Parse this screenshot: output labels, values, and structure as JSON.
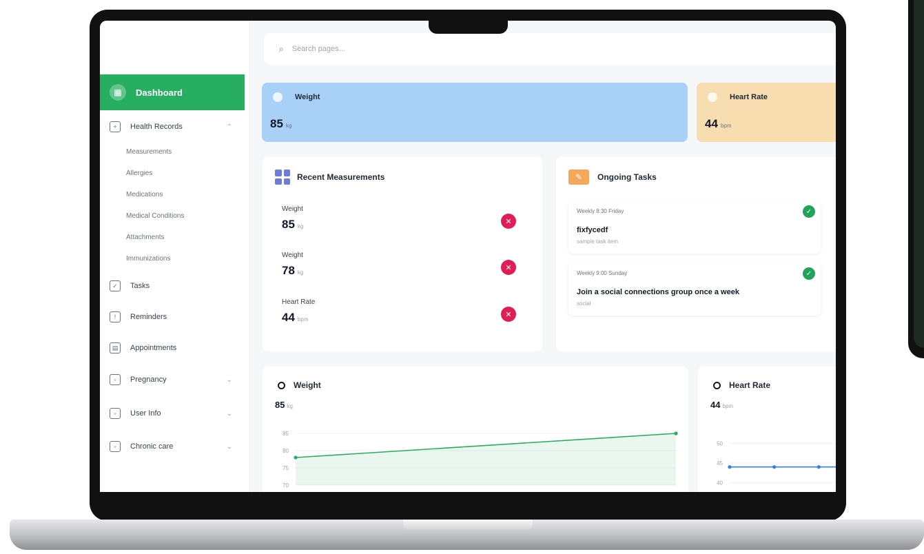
{
  "search": {
    "placeholder": "Search pages..."
  },
  "sidebar": {
    "active": "Dashboard",
    "health_records": "Health Records",
    "sub_items": [
      "Measurements",
      "Allergies",
      "Medications",
      "Medical Conditions",
      "Attachments",
      "Immunizations"
    ],
    "items": [
      "Tasks",
      "Reminders",
      "Appointments",
      "Pregnancy",
      "User Info",
      "Chronic care"
    ]
  },
  "stats": [
    {
      "label": "Weight",
      "value": "85",
      "unit": "kg",
      "color": "#a9d0f7"
    },
    {
      "label": "Heart Rate",
      "value": "44",
      "unit": "bpm",
      "color": "#f7ddb0"
    }
  ],
  "recent": {
    "title": "Recent Measurements",
    "rows": [
      {
        "label": "Weight",
        "value": "85",
        "unit": "kg"
      },
      {
        "label": "Weight",
        "value": "78",
        "unit": "kg"
      },
      {
        "label": "Heart Rate",
        "value": "44",
        "unit": "bpm"
      }
    ]
  },
  "tasks": {
    "title": "Ongoing Tasks",
    "cards": [
      {
        "meta": "Weekly 8:30  Friday",
        "title": "fixfycedf",
        "sub": "sample task item"
      },
      {
        "meta": "Weekly 9:00  Sunday",
        "title": "Join a social connections group once a week",
        "sub": "social"
      }
    ]
  },
  "charts": {
    "weight": {
      "title": "Weight",
      "value": "85",
      "unit": "kg",
      "y_ticks": [
        "85",
        "80",
        "75",
        "70"
      ]
    },
    "heart": {
      "title": "Heart Rate",
      "value": "44",
      "unit": "bpm",
      "y_ticks": [
        "50",
        "45",
        "40"
      ]
    }
  },
  "chart_data": [
    {
      "type": "area",
      "title": "Weight",
      "x": [
        1,
        2
      ],
      "values": [
        78,
        85
      ],
      "ylim": [
        70,
        86
      ]
    },
    {
      "type": "line",
      "title": "Heart Rate",
      "x": [
        1,
        2,
        3,
        4
      ],
      "values": [
        44,
        44,
        44,
        44
      ],
      "ylim": [
        38,
        52
      ]
    }
  ],
  "colors": {
    "accent": "#27ae60",
    "danger": "#e11d55",
    "success": "#22a35a"
  }
}
